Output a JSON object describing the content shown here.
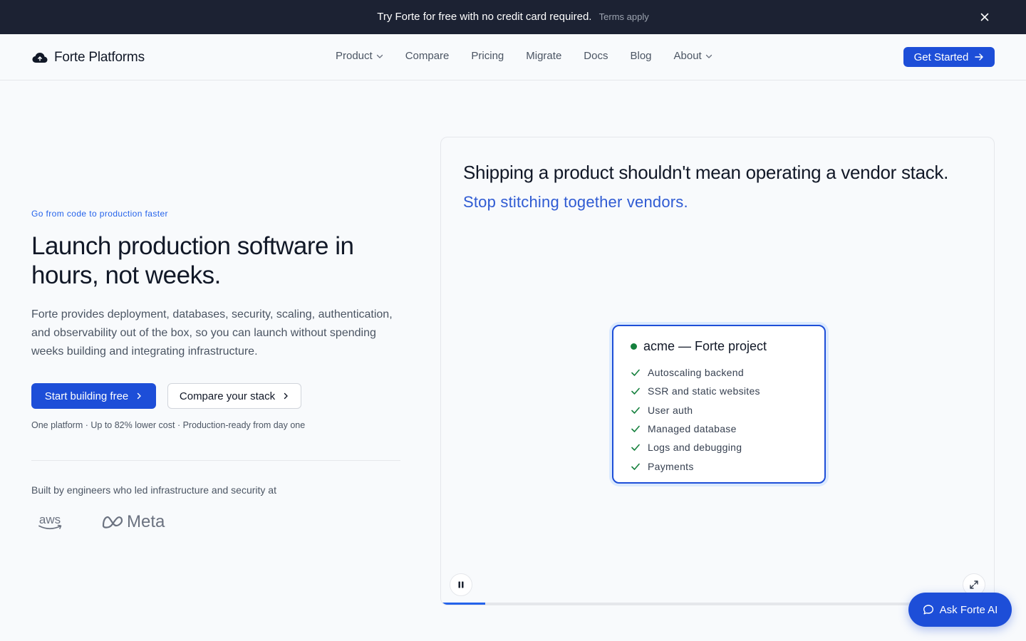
{
  "announcement": {
    "text": "Try Forte for free with no credit card required.",
    "terms": "Terms apply",
    "close_icon": "close-icon"
  },
  "brand": {
    "name": "Forte Platforms",
    "icon": "cloud-logo-icon"
  },
  "nav": {
    "items": [
      {
        "label": "Product",
        "dropdown": true
      },
      {
        "label": "Compare",
        "dropdown": false
      },
      {
        "label": "Pricing",
        "dropdown": false
      },
      {
        "label": "Migrate",
        "dropdown": false
      },
      {
        "label": "Docs",
        "dropdown": false
      },
      {
        "label": "Blog",
        "dropdown": false
      },
      {
        "label": "About",
        "dropdown": true
      }
    ],
    "cta": "Get Started"
  },
  "hero": {
    "eyebrow": "Go from code to production faster",
    "headline": "Launch production software in hours, not weeks.",
    "description": "Forte provides deployment, databases, security, scaling, authentication, and observability out of the box, so you can launch without spending weeks building and integrating infrastructure.",
    "primary_cta": "Start building free",
    "secondary_cta": "Compare your stack",
    "tagline": "One platform · Up to 82% lower cost · Production-ready from day one",
    "built_by": "Built by engineers who led infrastructure and security at",
    "logos": [
      "aws",
      "Meta"
    ]
  },
  "demo": {
    "title": "Shipping a product shouldn't mean operating a vendor stack.",
    "subtitle": "Stop stitching together vendors.",
    "project": {
      "title": "acme — Forte project",
      "features": [
        "Autoscaling backend",
        "SSR and static websites",
        "User auth",
        "Managed database",
        "Logs and debugging",
        "Payments"
      ]
    },
    "progress": 0.08
  },
  "assistant": {
    "label": "Ask Forte AI"
  },
  "colors": {
    "accent": "#1d4ed8",
    "announcement_bg": "#1c2233",
    "subtitle_blue": "#2f5bd3",
    "status_green": "#15803d"
  }
}
